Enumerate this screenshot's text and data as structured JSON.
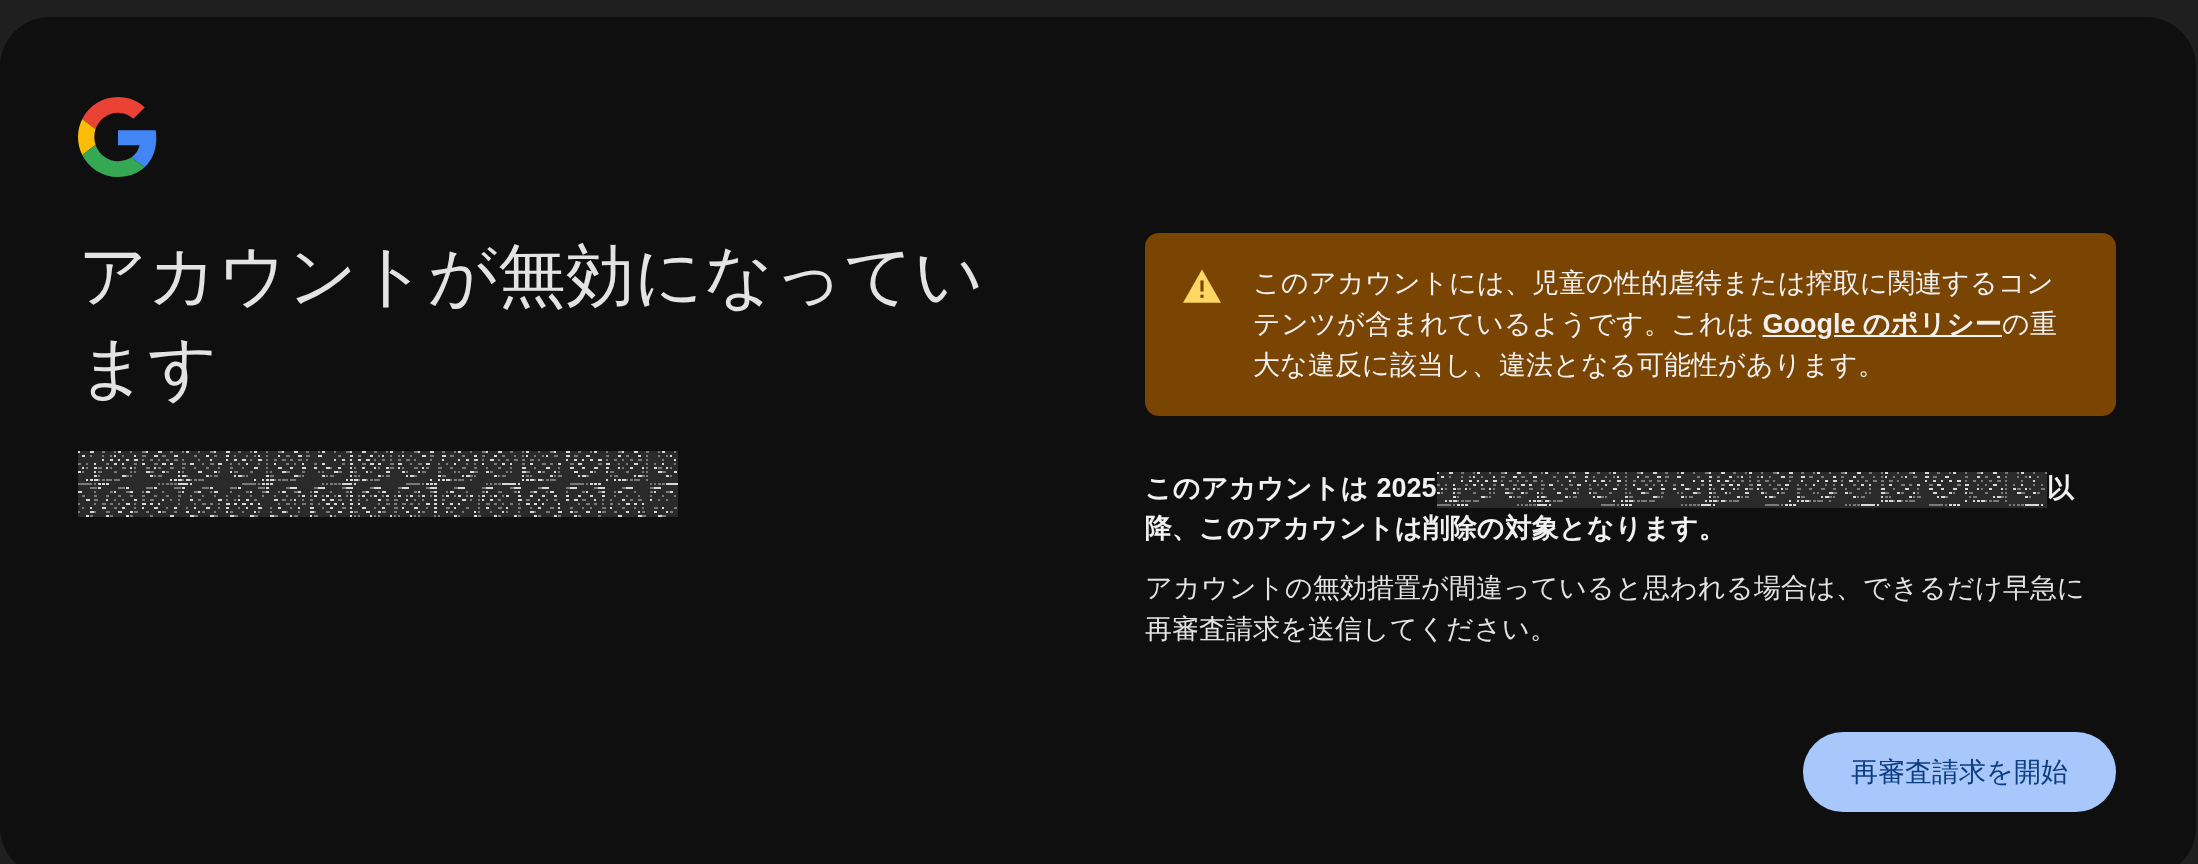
{
  "title": "アカウントが無効になっています",
  "subtitle": {
    "kind": "redacted"
  },
  "warning": {
    "parts": [
      {
        "kind": "text",
        "text": "このアカウントには、児童の性的虐待または搾取に関連するコンテンツが含まれているようです。これは "
      },
      {
        "kind": "link",
        "text": "Google のポリシー"
      },
      {
        "kind": "text",
        "text": "の重大な違反に該当し、違法となる可能性があります。"
      }
    ]
  },
  "deletion_notice": [
    {
      "kind": "text",
      "text": "このアカウントは 2025"
    },
    {
      "kind": "redacted"
    },
    {
      "kind": "text",
      "text": "以"
    },
    {
      "kind": "text",
      "text": "降、このアカウントは削除の対象となります。"
    }
  ],
  "appeal_text": "アカウントの無効措置が間違っていると思われる場合は、できるだけ早急に再審査請求を送信してください。",
  "button": "再審査請求を開始"
}
